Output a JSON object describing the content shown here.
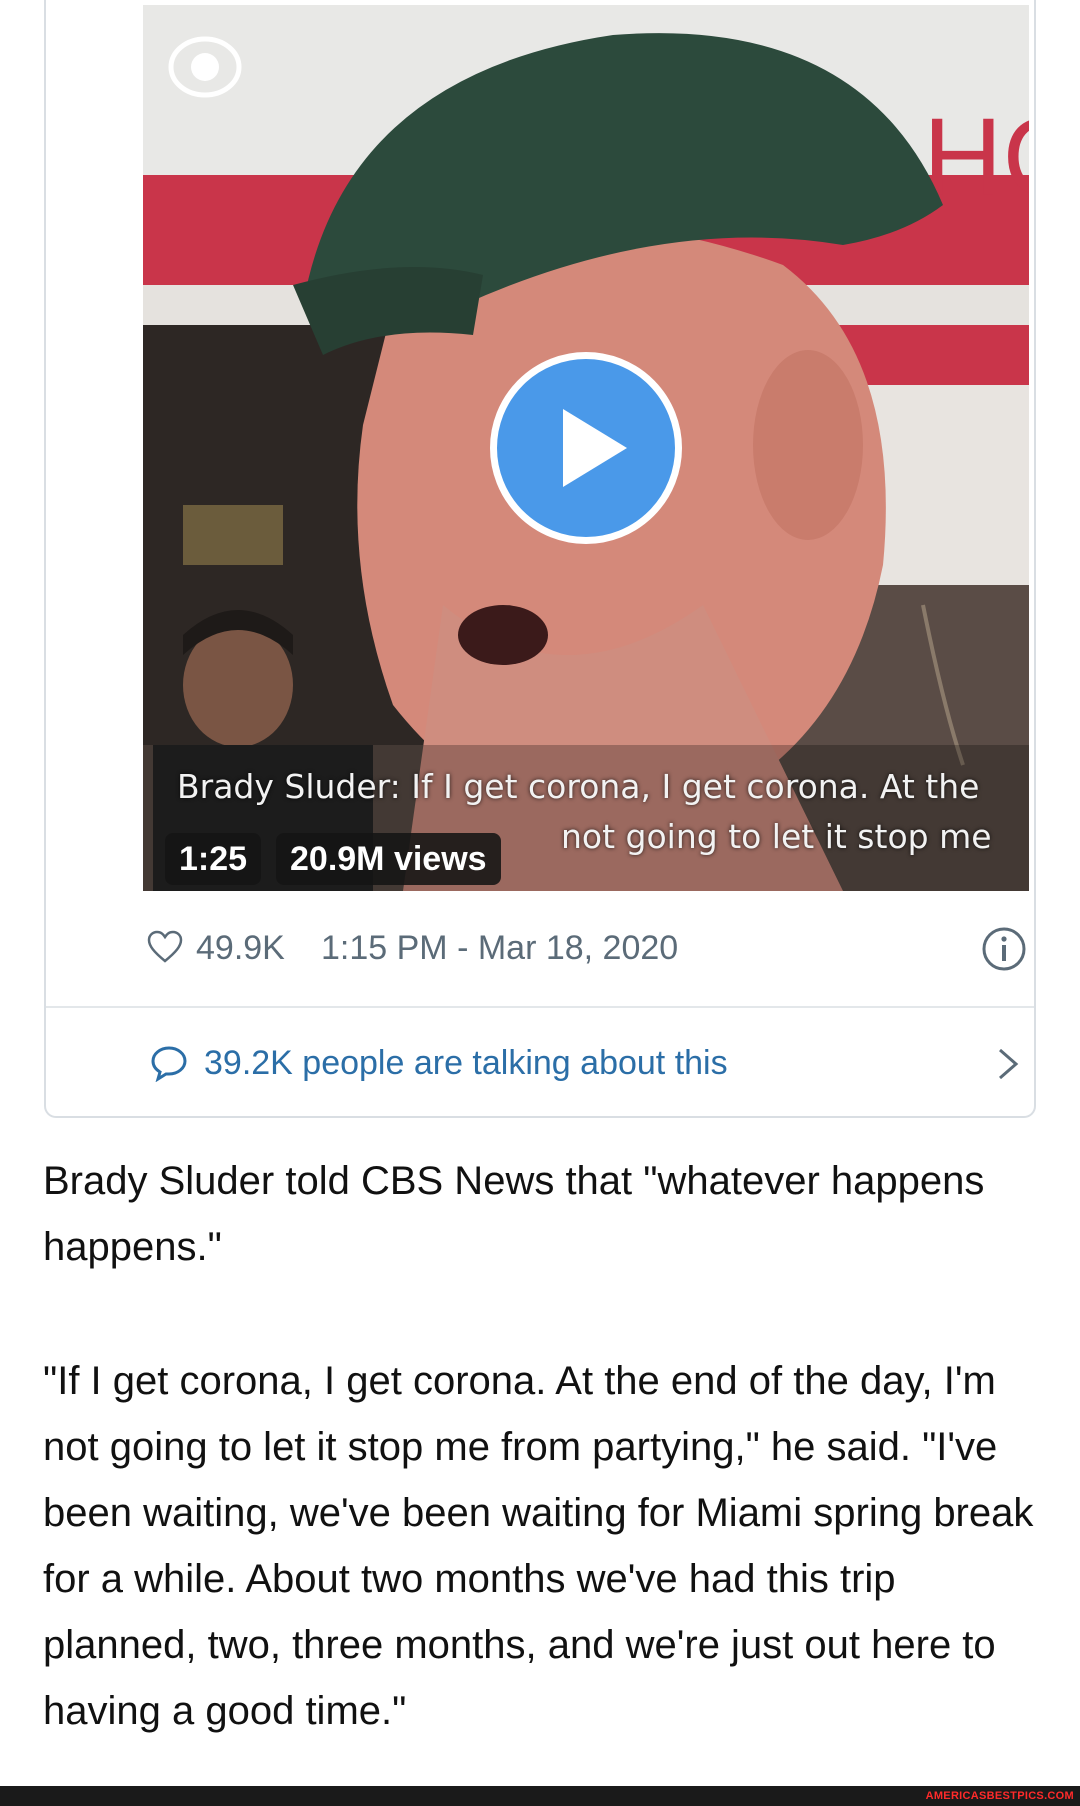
{
  "video": {
    "caption_line1": "Brady Sluder: If I get corona, I get corona. At the",
    "caption_line2": "not going to let it stop me",
    "duration": "1:25",
    "views": "20.9M views"
  },
  "tweet": {
    "likes": "49.9K",
    "timestamp": "1:15 PM - Mar 18, 2020",
    "talking": "39.2K people are talking about this"
  },
  "article": {
    "paragraph1": "Brady Sluder told CBS News that \"whatever happens happens.\"",
    "paragraph2": "\"If I get corona, I get corona. At the end of the day, I'm not going to let it stop me from partying,\" he said. \"I've been waiting, we've been waiting for Miami spring break for a while. About two months we've had this trip planned, two, three months, and we're just out here to having a good time.\""
  },
  "footer": {
    "watermark": "AMERICASBESTPICS.COM"
  },
  "colors": {
    "play_button": "#4a99e9",
    "link_text": "#2b6ea7",
    "meta_text": "#5b6b78",
    "watermark": "#ff2a2a"
  },
  "icons": [
    "cbs-eye-logo",
    "play-icon",
    "heart-icon",
    "info-icon",
    "speech-bubble-icon",
    "chevron-right-icon"
  ]
}
